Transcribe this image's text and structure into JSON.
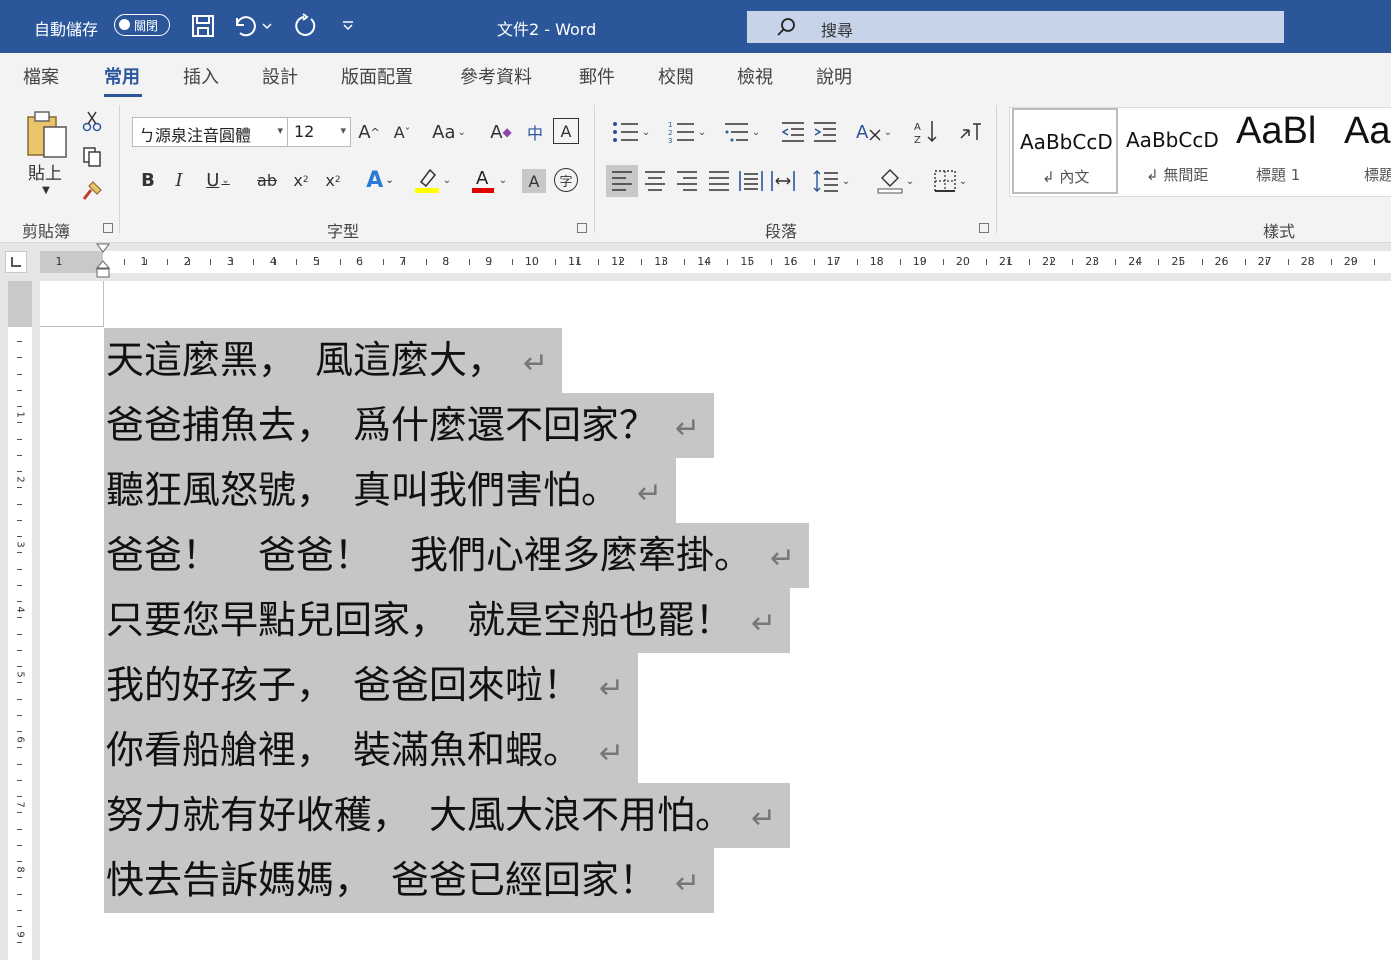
{
  "titlebar": {
    "autosave_label": "自動儲存",
    "autosave_state": "關閉",
    "doc_title": "文件2  -  Word",
    "search_placeholder": "搜尋"
  },
  "tabs": [
    {
      "label": "檔案"
    },
    {
      "label": "常用"
    },
    {
      "label": "插入"
    },
    {
      "label": "設計"
    },
    {
      "label": "版面配置"
    },
    {
      "label": "參考資料"
    },
    {
      "label": "郵件"
    },
    {
      "label": "校閱"
    },
    {
      "label": "檢視"
    },
    {
      "label": "說明"
    }
  ],
  "active_tab": "常用",
  "ribbon": {
    "clipboard": {
      "paste_label": "貼上",
      "group_label": "剪貼簿"
    },
    "font": {
      "font_name": "ㄅ源泉注音圓體",
      "font_size": "12",
      "group_label": "字型"
    },
    "paragraph": {
      "group_label": "段落"
    },
    "styles": {
      "group_label": "樣式",
      "items": [
        {
          "sample": "AaBbCcD",
          "name": "↲ 內文"
        },
        {
          "sample": "AaBbCcD",
          "name": "↲ 無間距"
        },
        {
          "sample": "AaBl",
          "name": "標題 1"
        },
        {
          "sample": "Aa",
          "name": "標題"
        }
      ]
    }
  },
  "ruler": {
    "left_number": "1",
    "numbers": [
      "1",
      "2",
      "3",
      "4",
      "5",
      "6",
      "7",
      "8",
      "9",
      "10",
      "11",
      "12",
      "13",
      "14",
      "15",
      "16",
      "17",
      "18",
      "19",
      "20",
      "21",
      "22",
      "23",
      "24",
      "25",
      "26",
      "27",
      "28",
      "29"
    ]
  },
  "vruler": {
    "numbers": [
      "1",
      "2",
      "3",
      "4",
      "5",
      "6",
      "7",
      "8",
      "9"
    ]
  },
  "document": {
    "lines": [
      "天這麼黑，　風這麼大，",
      "爸爸捕魚去，　爲什麼還不回家？",
      "聽狂風怒號，　真叫我們害怕。",
      "爸爸！　爸爸！　我們心裡多麼牽掛。",
      "只要您早點兒回家，　就是空船也罷！",
      "我的好孩子，　爸爸回來啦！",
      "你看船艙裡，　裝滿魚和蝦。",
      "努力就有好收穫，　大風大浪不用怕。",
      "快去告訴媽媽，　爸爸已經回家！"
    ],
    "paragraph_mark": "↵"
  },
  "colors": {
    "titlebar": "#2b579a",
    "selection": "#c6c6c6",
    "ribbon": "#f3f3f3"
  }
}
